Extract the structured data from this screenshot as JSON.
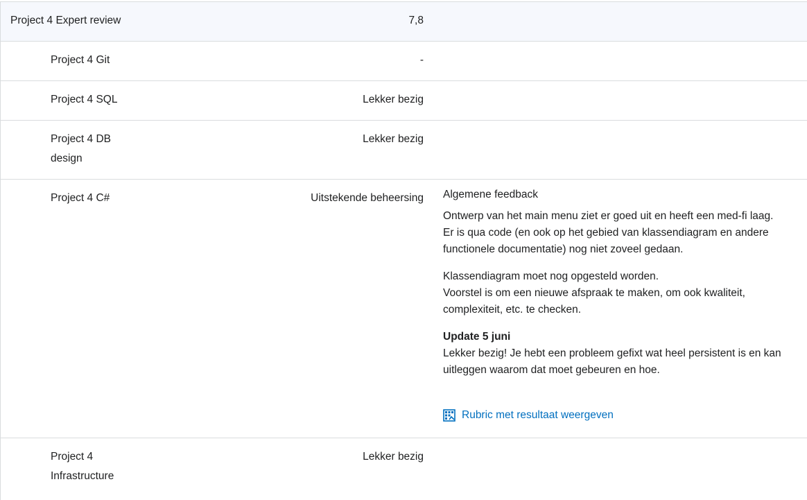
{
  "rows": [
    {
      "name": "Project 4 Expert review",
      "score": "7,8"
    },
    {
      "name": "Project 4 Git",
      "score": "-"
    },
    {
      "name": "Project 4 SQL",
      "score": "Lekker bezig"
    },
    {
      "name_line1": "Project 4 DB",
      "name_line2": "design",
      "score": "Lekker bezig"
    },
    {
      "name": "Project 4 C#",
      "score": "Uitstekende beheersing",
      "feedback": {
        "heading": "Algemene feedback",
        "para1_line1": "Ontwerp van het main menu ziet er goed uit en heeft een med-fi laag.",
        "para1_line2": "Er is qua code (en ook op het gebied van klassendiagram en andere",
        "para1_line3": "functionele documentatie) nog niet zoveel gedaan.",
        "para2_line1": "Klassendiagram moet nog opgesteld worden.",
        "para2_line2": "Voorstel is om een nieuwe afspraak te maken, om ook kwaliteit,",
        "para2_line3": "complexiteit, etc. te checken.",
        "update_title": "Update 5 juni",
        "update_line1": "Lekker bezig! Je hebt een probleem gefixt wat heel persistent is en kan",
        "update_line2": "uitleggen waarom dat moet gebeuren en hoe.",
        "rubric_link": "Rubric met resultaat weergeven"
      }
    },
    {
      "name_line1": "Project 4",
      "name_line2": "Infrastructure",
      "score": "Lekker bezig"
    }
  ],
  "colors": {
    "link": "#006fbf",
    "category_bg": "#f6f8fd",
    "border": "#d9dcde"
  },
  "icons": {
    "rubric": "rubric-grid-icon"
  }
}
